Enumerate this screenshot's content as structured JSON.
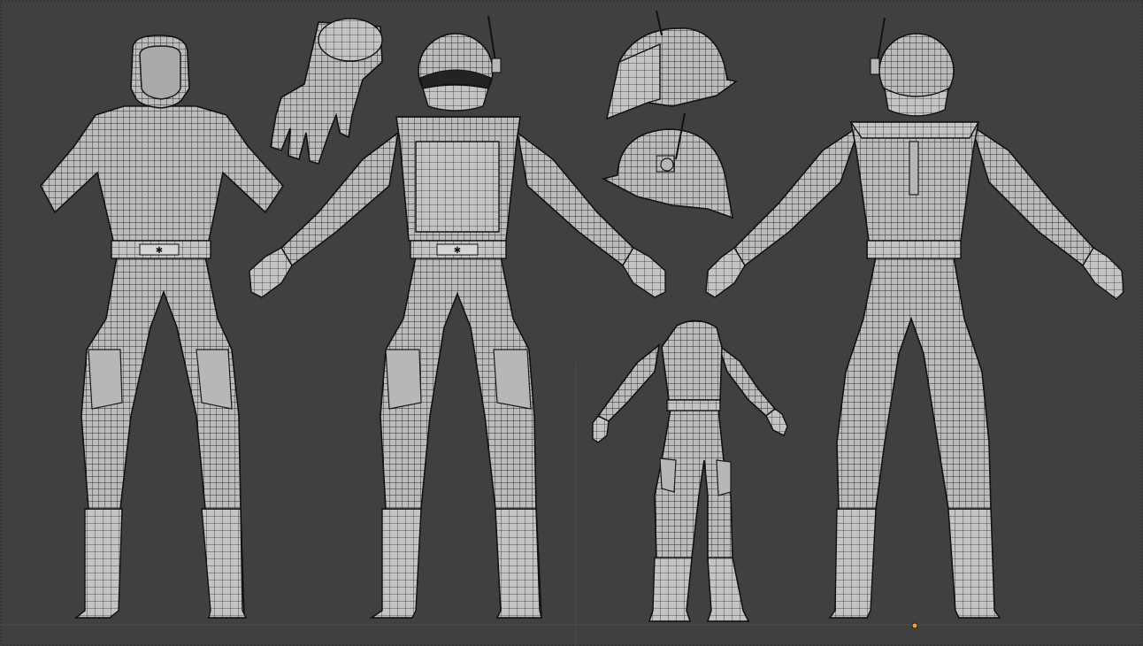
{
  "app": {
    "name": "3D Viewport",
    "mode": "wireframe-overlay"
  },
  "viewport": {
    "background_color": "#404040",
    "mesh_color": "#bdbdbd",
    "wire_color": "#1a1a1a",
    "origin_marker_color": "#f0a030"
  },
  "objects": [
    {
      "name_icon": "character-front-no-helmet"
    },
    {
      "name_icon": "glove"
    },
    {
      "name_icon": "character-front-helmet"
    },
    {
      "name_icon": "helmet-angled"
    },
    {
      "name_icon": "helmet-side"
    },
    {
      "name_icon": "character-three-quarter"
    },
    {
      "name_icon": "character-back"
    }
  ]
}
